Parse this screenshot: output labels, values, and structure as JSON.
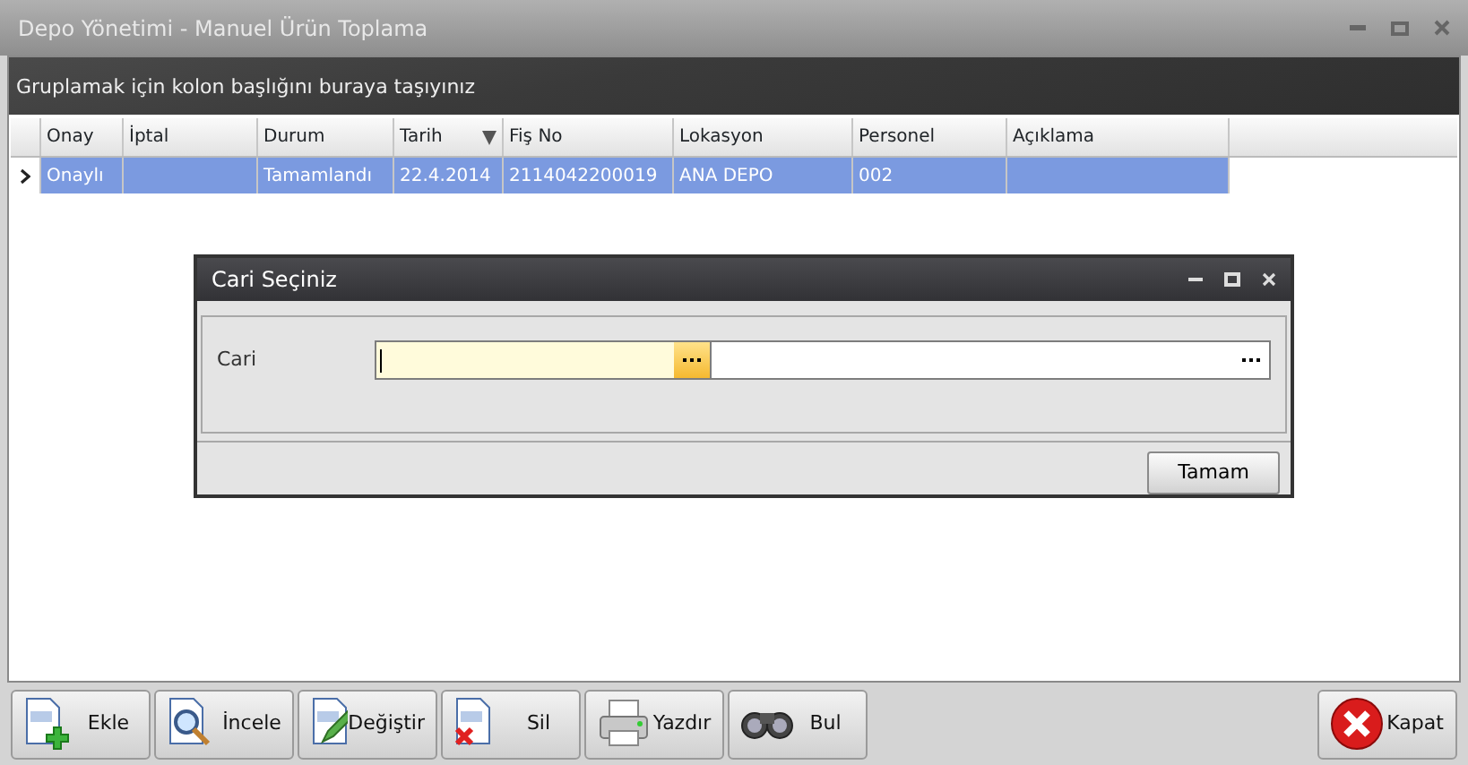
{
  "window": {
    "title": "Depo Yönetimi - Manuel Ürün Toplama"
  },
  "group_panel": {
    "hint": "Gruplamak için kolon başlığını buraya taşıyınız"
  },
  "table": {
    "columns": [
      {
        "label": "Onay",
        "sorted": false
      },
      {
        "label": "İptal",
        "sorted": false
      },
      {
        "label": "Durum",
        "sorted": false
      },
      {
        "label": "Tarih",
        "sorted": true
      },
      {
        "label": "Fiş No",
        "sorted": false
      },
      {
        "label": "Lokasyon",
        "sorted": false
      },
      {
        "label": "Personel",
        "sorted": false
      },
      {
        "label": "Açıklama",
        "sorted": false
      }
    ],
    "rows": [
      {
        "selected": true,
        "cells": [
          "Onaylı",
          "",
          "Tamamlandı",
          "22.4.2014",
          "2114042200019",
          "ANA DEPO",
          "002",
          ""
        ]
      }
    ]
  },
  "dialog": {
    "title": "Cari Seçiniz",
    "field_label": "Cari",
    "ok_button": "Tamam"
  },
  "toolbar": [
    {
      "label": "Ekle"
    },
    {
      "label": "İncele"
    },
    {
      "label": "Değiştir"
    },
    {
      "label": "Sil"
    },
    {
      "label": "Yazdır"
    },
    {
      "label": "Bul"
    }
  ],
  "close_button": {
    "label": "Kapat"
  }
}
